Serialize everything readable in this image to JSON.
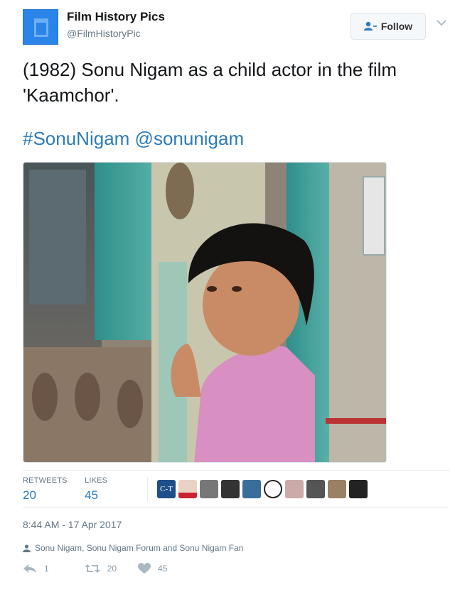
{
  "header": {
    "display_name": "Film History Pics",
    "handle": "@FilmHistoryPic",
    "follow_label": "Follow"
  },
  "tweet": {
    "text": "(1982) Sonu Nigam as a child actor in the film 'Kaamchor'.",
    "hashtag": "#SonuNigam",
    "mention": "@sonunigam"
  },
  "stats": {
    "retweets_label": "RETWEETS",
    "retweets_count": "20",
    "likes_label": "LIKES",
    "likes_count": "45",
    "likers_badge": "C-T"
  },
  "meta": {
    "timestamp": "8:44 AM - 17 Apr 2017",
    "reply_context": "Sonu Nigam, Sonu Nigam Forum and Sonu Nigam Fan"
  },
  "actions": {
    "reply_count": "1",
    "retweet_count": "20",
    "like_count": "45"
  },
  "colors": {
    "link": "#2b7bb9",
    "muted": "#657786",
    "avatar": "#2b84e8"
  }
}
